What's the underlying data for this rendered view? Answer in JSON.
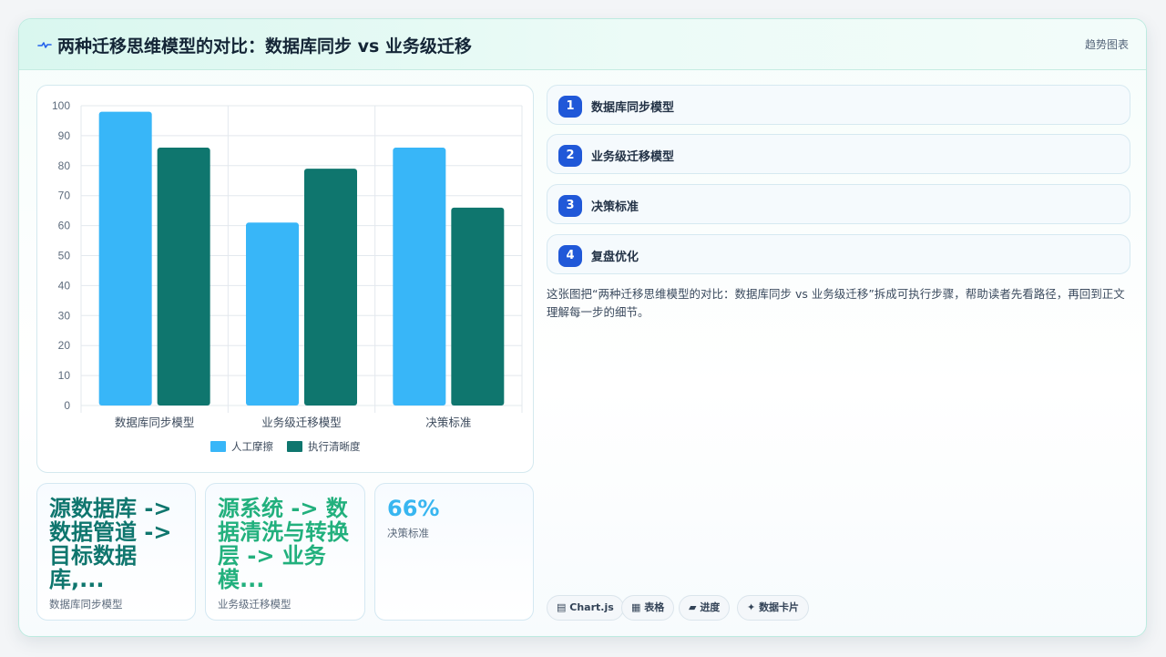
{
  "header": {
    "icon": "pulse-icon",
    "title": "两种迁移思维模型的对比：数据库同步 vs 业务级迁移",
    "badge": "趋势图表"
  },
  "chart_data": {
    "type": "bar",
    "categories": [
      "数据库同步模型",
      "业务级迁移模型",
      "决策标准"
    ],
    "series": [
      {
        "name": "人工摩擦",
        "values": [
          98,
          61,
          86
        ],
        "color": "#38b6f8"
      },
      {
        "name": "执行清晰度",
        "values": [
          86,
          79,
          66
        ],
        "color": "#0f766e"
      }
    ],
    "ylim": [
      0,
      100
    ],
    "yticks": [
      0,
      10,
      20,
      30,
      40,
      50,
      60,
      70,
      80,
      90,
      100
    ],
    "grid": true,
    "legend": "bottom"
  },
  "stats": [
    {
      "value": "源数据库 -> 数据管道 -> 目标数据库,...",
      "label": "数据库同步模型",
      "color": "#0f766e"
    },
    {
      "value": "源系统 -> 数据清洗与转换层 -> 业务模...",
      "label": "业务级迁移模型",
      "color": "#22b07d"
    },
    {
      "value": "66%",
      "label": "决策标准",
      "color": "#38b6f0"
    }
  ],
  "steps": [
    {
      "num": "1",
      "label": "数据库同步模型"
    },
    {
      "num": "2",
      "label": "业务级迁移模型"
    },
    {
      "num": "3",
      "label": "决策标准"
    },
    {
      "num": "4",
      "label": "复盘优化"
    }
  ],
  "description": "这张图把“两种迁移思维模型的对比：数据库同步 vs 业务级迁移”拆成可执行步骤，帮助读者先看路径，再回到正文理解每一步的细节。",
  "tags": [
    {
      "icon": "chart-icon",
      "glyph": "▤",
      "label": "Chart.js"
    },
    {
      "icon": "table-icon",
      "glyph": "▦",
      "label": "表格"
    },
    {
      "icon": "progress-icon",
      "glyph": "▰",
      "label": "进度"
    },
    {
      "icon": "sparkle-icon",
      "glyph": "✦",
      "label": "数据卡片"
    }
  ]
}
